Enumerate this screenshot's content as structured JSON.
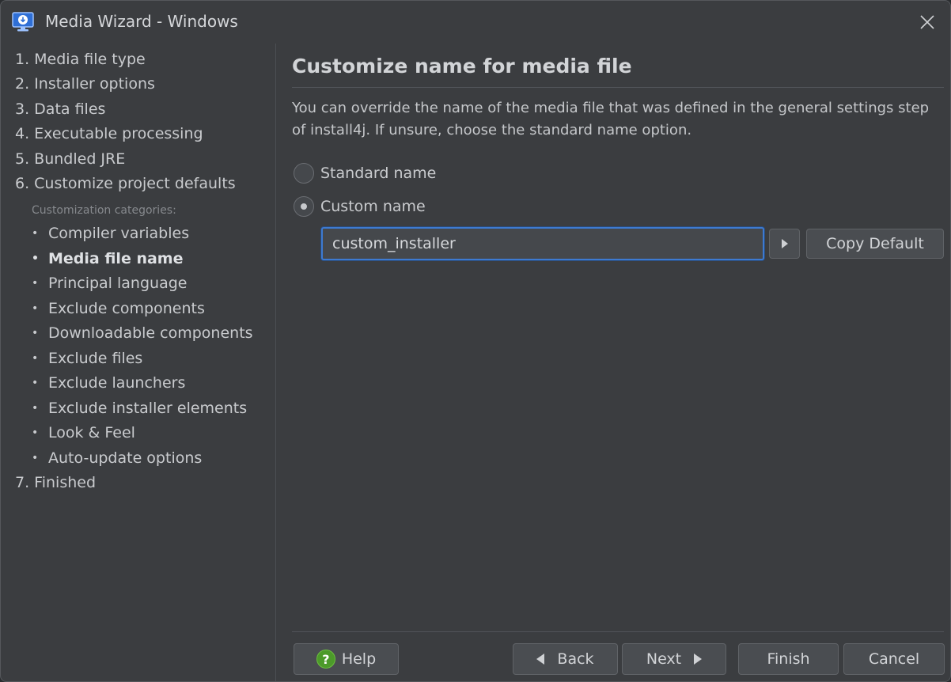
{
  "window": {
    "title": "Media Wizard - Windows"
  },
  "sidebar": {
    "steps": [
      {
        "label": "1. Media file type"
      },
      {
        "label": "2. Installer options"
      },
      {
        "label": "3. Data files"
      },
      {
        "label": "4. Executable processing"
      },
      {
        "label": "5. Bundled JRE"
      },
      {
        "label": "6. Customize project defaults"
      },
      {
        "label": "7. Finished"
      }
    ],
    "categories_label": "Customization categories:",
    "bullet": "•",
    "categories": [
      {
        "label": "Compiler variables"
      },
      {
        "label": "Media file name",
        "active": true
      },
      {
        "label": "Principal language"
      },
      {
        "label": "Exclude components"
      },
      {
        "label": "Downloadable components"
      },
      {
        "label": "Exclude files"
      },
      {
        "label": "Exclude launchers"
      },
      {
        "label": "Exclude installer elements"
      },
      {
        "label": "Look & Feel"
      },
      {
        "label": "Auto-update options"
      }
    ]
  },
  "main": {
    "heading": "Customize name for media file",
    "description": "You can override the name of the media file that was defined in the general settings step of install4j. If unsure, choose the standard name option.",
    "options": [
      {
        "label": "Standard name",
        "checked": false
      },
      {
        "label": "Custom name",
        "checked": true
      }
    ],
    "custom_name_value": "custom_installer",
    "copy_default_label": "Copy Default"
  },
  "footer": {
    "help_label": "Help",
    "help_icon_glyph": "?",
    "back_label": "Back",
    "next_label": "Next",
    "finish_label": "Finish",
    "cancel_label": "Cancel"
  },
  "colors": {
    "window_bg": "#3b3d40",
    "accent_focus": "#3d7ad1",
    "help_icon": "#4c9a2a"
  }
}
